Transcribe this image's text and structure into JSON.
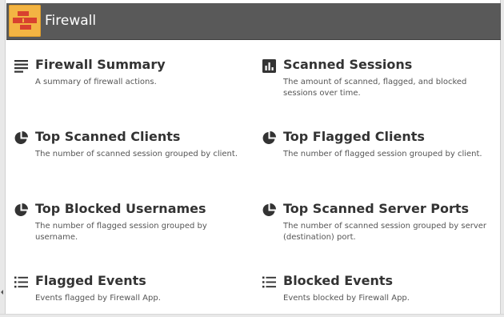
{
  "header": {
    "title": "Firewall",
    "icon": "firewall-brick-icon",
    "icon_color": "#f3b443",
    "bar_color": "#595959"
  },
  "reports": [
    {
      "title": "Firewall Summary",
      "description": "A summary of firewall actions.",
      "icon": "text-lines-icon"
    },
    {
      "title": "Scanned Sessions",
      "description": "The amount of scanned, flagged, and blocked sessions over time.",
      "icon": "bar-chart-icon"
    },
    {
      "title": "Top Scanned Clients",
      "description": "The number of scanned session grouped by client.",
      "icon": "pie-chart-icon"
    },
    {
      "title": "Top Flagged Clients",
      "description": "The number of flagged session grouped by client.",
      "icon": "pie-chart-icon"
    },
    {
      "title": "Top Blocked Usernames",
      "description": "The number of flagged session grouped by username.",
      "icon": "pie-chart-icon"
    },
    {
      "title": "Top Scanned Server Ports",
      "description": "The number of scanned session grouped by server (destination) port.",
      "icon": "pie-chart-icon"
    },
    {
      "title": "Flagged Events",
      "description": "Events flagged by Firewall App.",
      "icon": "bullet-list-icon"
    },
    {
      "title": "Blocked Events",
      "description": "Events blocked by Firewall App.",
      "icon": "bullet-list-icon"
    }
  ]
}
